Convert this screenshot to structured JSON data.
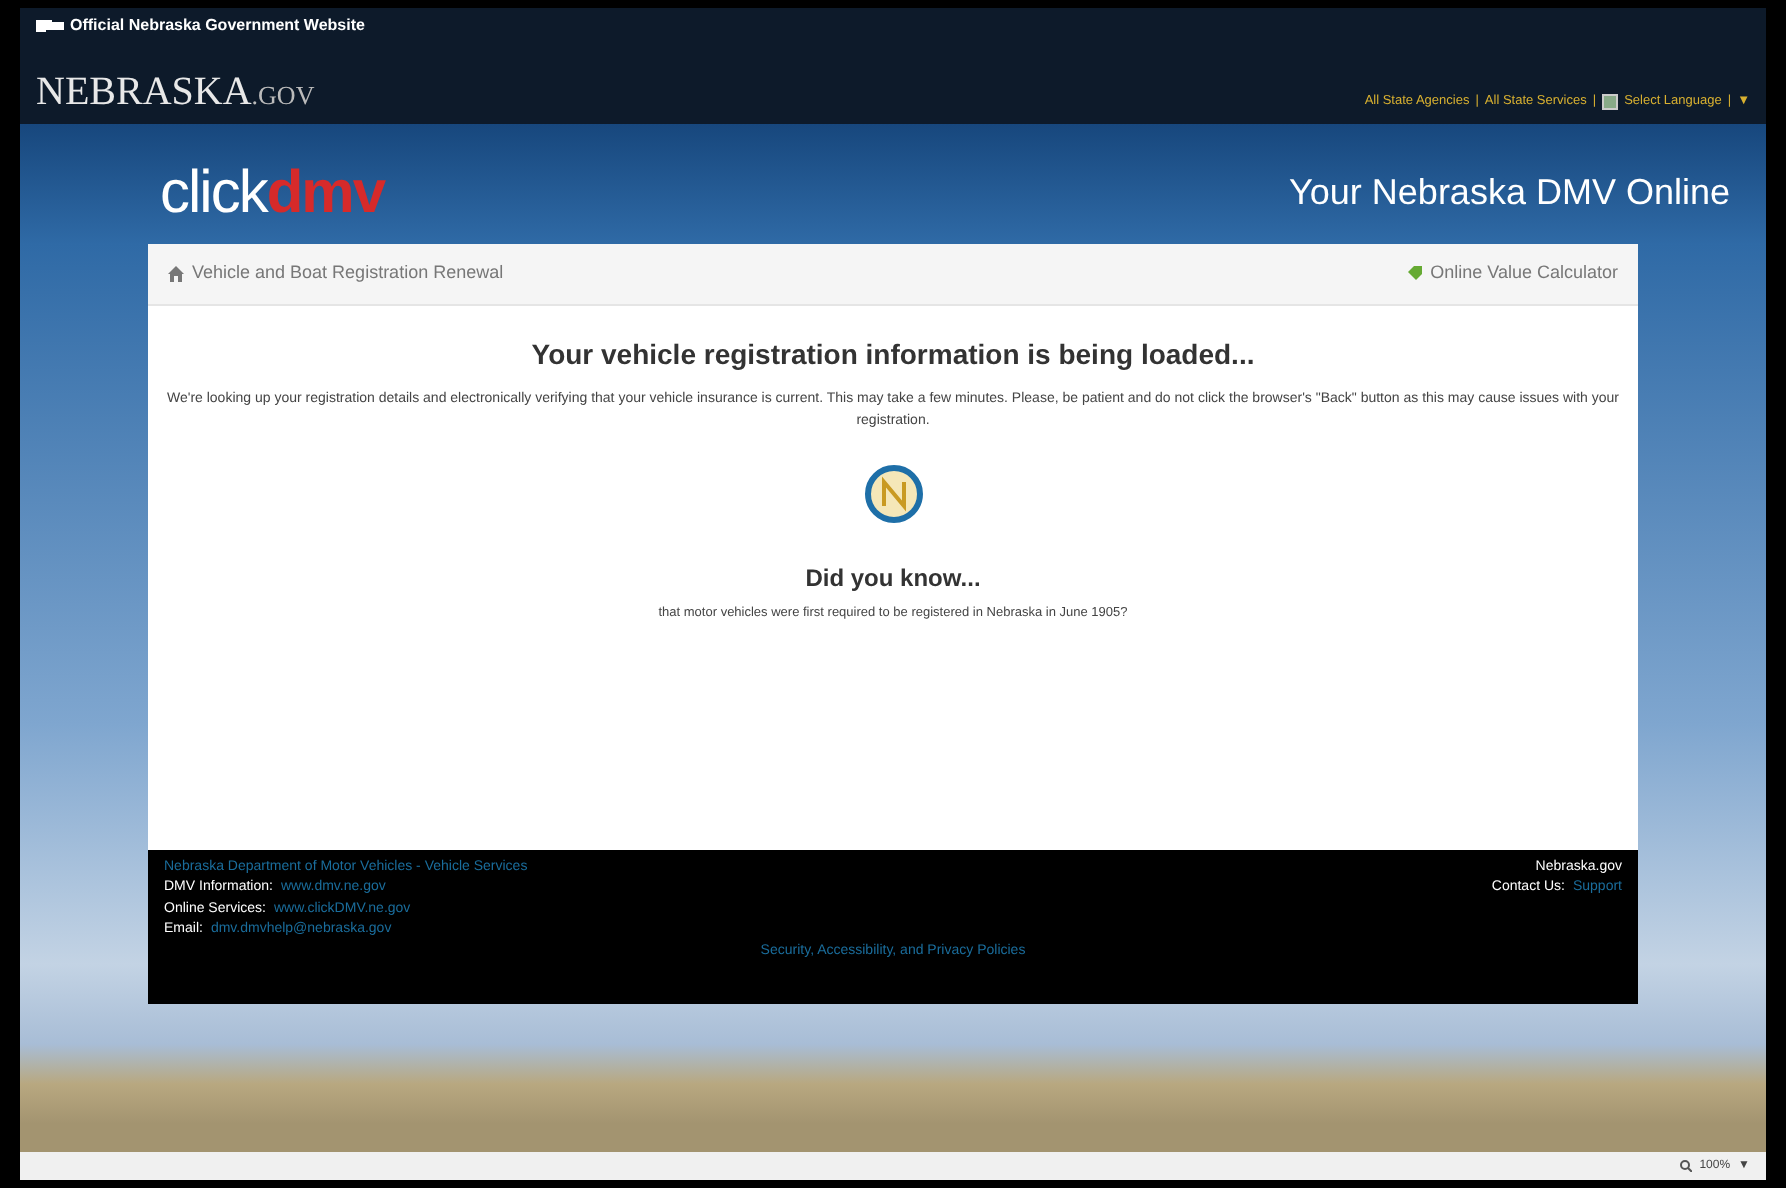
{
  "top_bar": {
    "official_text": "Official Nebraska Government Website",
    "logo_main": "NEBRASKA",
    "logo_suffix": ".GOV",
    "links": [
      "All State Agencies",
      "All State Services"
    ],
    "separator": "|",
    "language": "Select Language",
    "language_caret": "▼"
  },
  "header": {
    "logo_click": "click",
    "logo_dmv": "dmv",
    "tagline": "Your Nebraska DMV Online"
  },
  "card": {
    "breadcrumb": "Vehicle and Boat Registration Renewal",
    "calculator_link": "Online Value Calculator",
    "heading": "Your vehicle registration information is being loaded...",
    "message": "We're looking up your registration details and electronically verifying that your vehicle insurance is current. This may take a few minutes. Please, be patient and do not click the browser's \"Back\" button as this may cause issues with your registration.",
    "fact_heading": "Did you know...",
    "fact": "that motor vehicles were first required to be registered in Nebraska in June 1905?"
  },
  "footer": {
    "department": "Nebraska Department of Motor Vehicles - Vehicle Services",
    "lines": [
      {
        "label": "DMV Information:",
        "value": "www.dmv.ne.gov"
      },
      {
        "label": "Online Services:",
        "value": "www.clickDMV.ne.gov"
      },
      {
        "label": "Email:",
        "value": "dmv.dmvhelp@nebraska.gov"
      }
    ],
    "site": "Nebraska.gov",
    "contact_label": "Contact Us:",
    "contact_link": "Support",
    "policies": "Security, Accessibility, and Privacy Policies"
  },
  "status_bar": {
    "zoom": "100%",
    "caret": "▼"
  }
}
